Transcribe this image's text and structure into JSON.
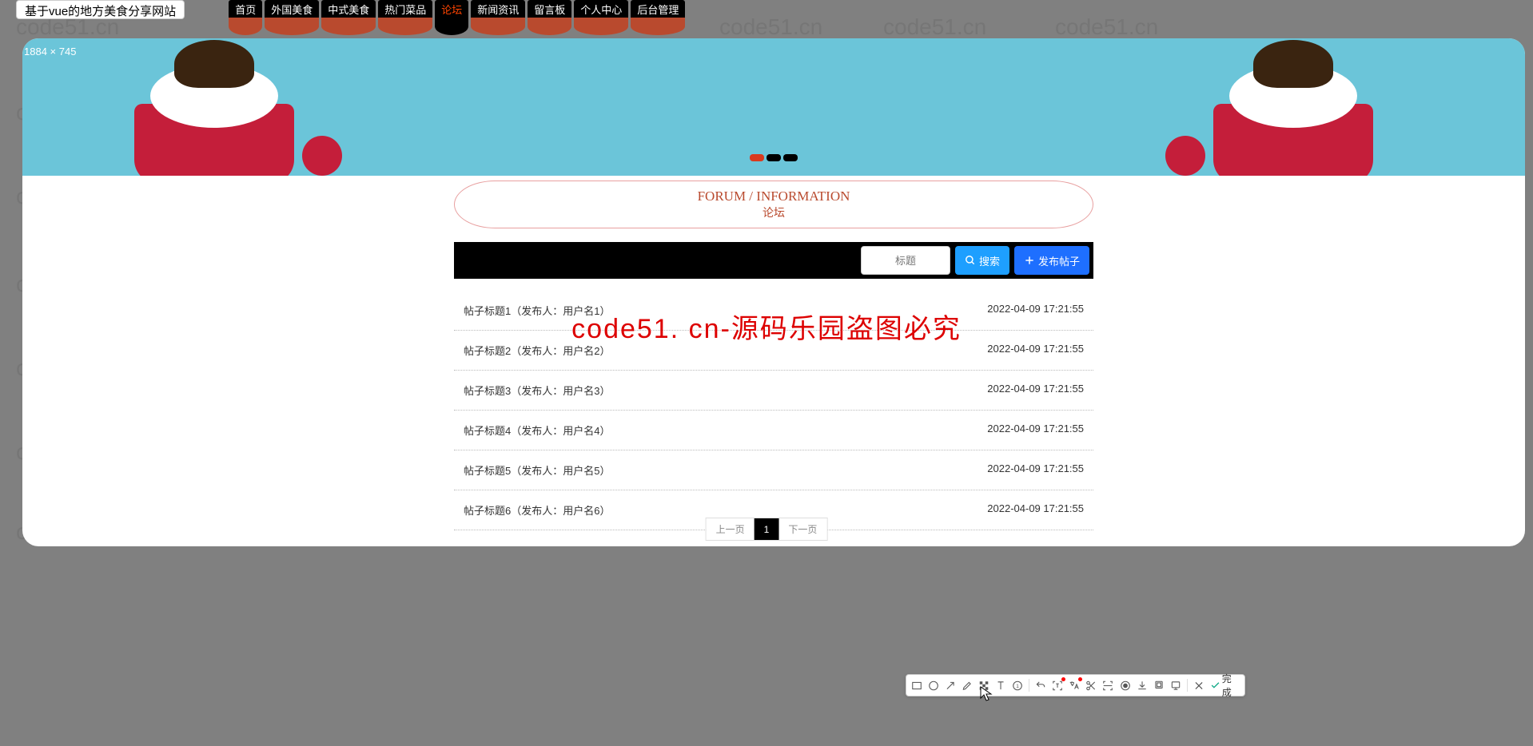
{
  "dimension_label": "1884 × 745",
  "site_title": "基于vue的地方美食分享网站",
  "nav": [
    {
      "label": "首页",
      "active": false
    },
    {
      "label": "外国美食",
      "active": false
    },
    {
      "label": "中式美食",
      "active": false
    },
    {
      "label": "热门菜品",
      "active": false
    },
    {
      "label": "论坛",
      "active": true
    },
    {
      "label": "新闻资讯",
      "active": false
    },
    {
      "label": "留言板",
      "active": false
    },
    {
      "label": "个人中心",
      "active": false
    },
    {
      "label": "后台管理",
      "active": false
    }
  ],
  "section": {
    "title_en": "FORUM / INFORMATION",
    "title_cn": "论坛"
  },
  "search": {
    "placeholder": "标题",
    "search_btn": "搜索",
    "post_btn": "发布帖子"
  },
  "posts": [
    {
      "title": "帖子标题1（发布人：用户名1）",
      "date": "2022-04-09 17:21:55"
    },
    {
      "title": "帖子标题2（发布人：用户名2）",
      "date": "2022-04-09 17:21:55"
    },
    {
      "title": "帖子标题3（发布人：用户名3）",
      "date": "2022-04-09 17:21:55"
    },
    {
      "title": "帖子标题4（发布人：用户名4）",
      "date": "2022-04-09 17:21:55"
    },
    {
      "title": "帖子标题5（发布人：用户名5）",
      "date": "2022-04-09 17:21:55"
    },
    {
      "title": "帖子标题6（发布人：用户名6）",
      "date": "2022-04-09 17:21:55"
    }
  ],
  "pagination": {
    "prev": "上一页",
    "current": "1",
    "next": "下一页"
  },
  "red_watermark": "code51. cn-源码乐园盗图必究",
  "watermark_text": "code51.cn",
  "toolbar_done": "完成"
}
